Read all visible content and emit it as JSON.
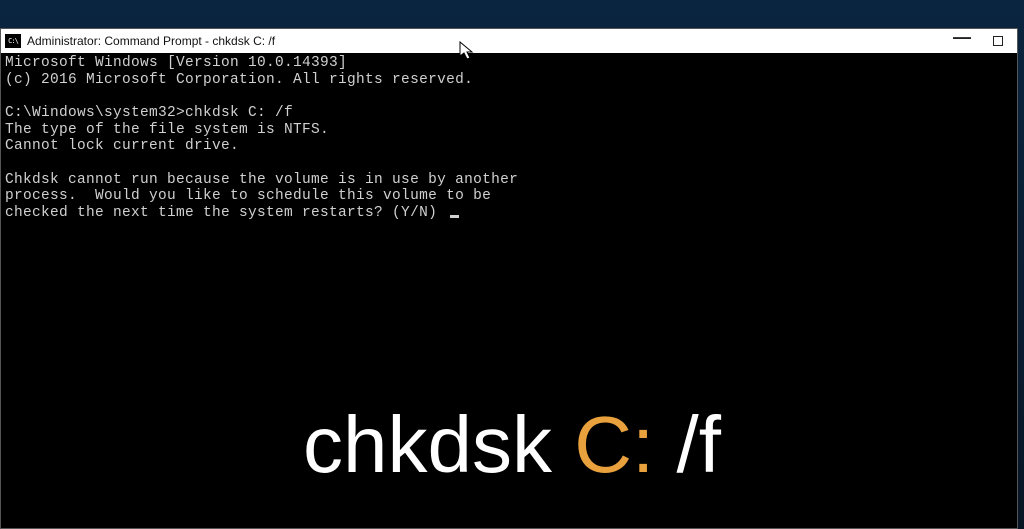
{
  "window": {
    "title": "Administrator: Command Prompt - chkdsk C: /f",
    "icon_glyph": "C:\\"
  },
  "terminal": {
    "line1": "Microsoft Windows [Version 10.0.14393]",
    "line2": "(c) 2016 Microsoft Corporation. All rights reserved.",
    "line3": "",
    "line4": "C:\\Windows\\system32>chkdsk C: /f",
    "line5": "The type of the file system is NTFS.",
    "line6": "Cannot lock current drive.",
    "line7": "",
    "line8": "Chkdsk cannot run because the volume is in use by another",
    "line9": "process.  Would you like to schedule this volume to be",
    "line10": "checked the next time the system restarts? (Y/N) "
  },
  "overlay": {
    "part1": "chkdsk ",
    "part2": "C:",
    "part3": " /f"
  }
}
